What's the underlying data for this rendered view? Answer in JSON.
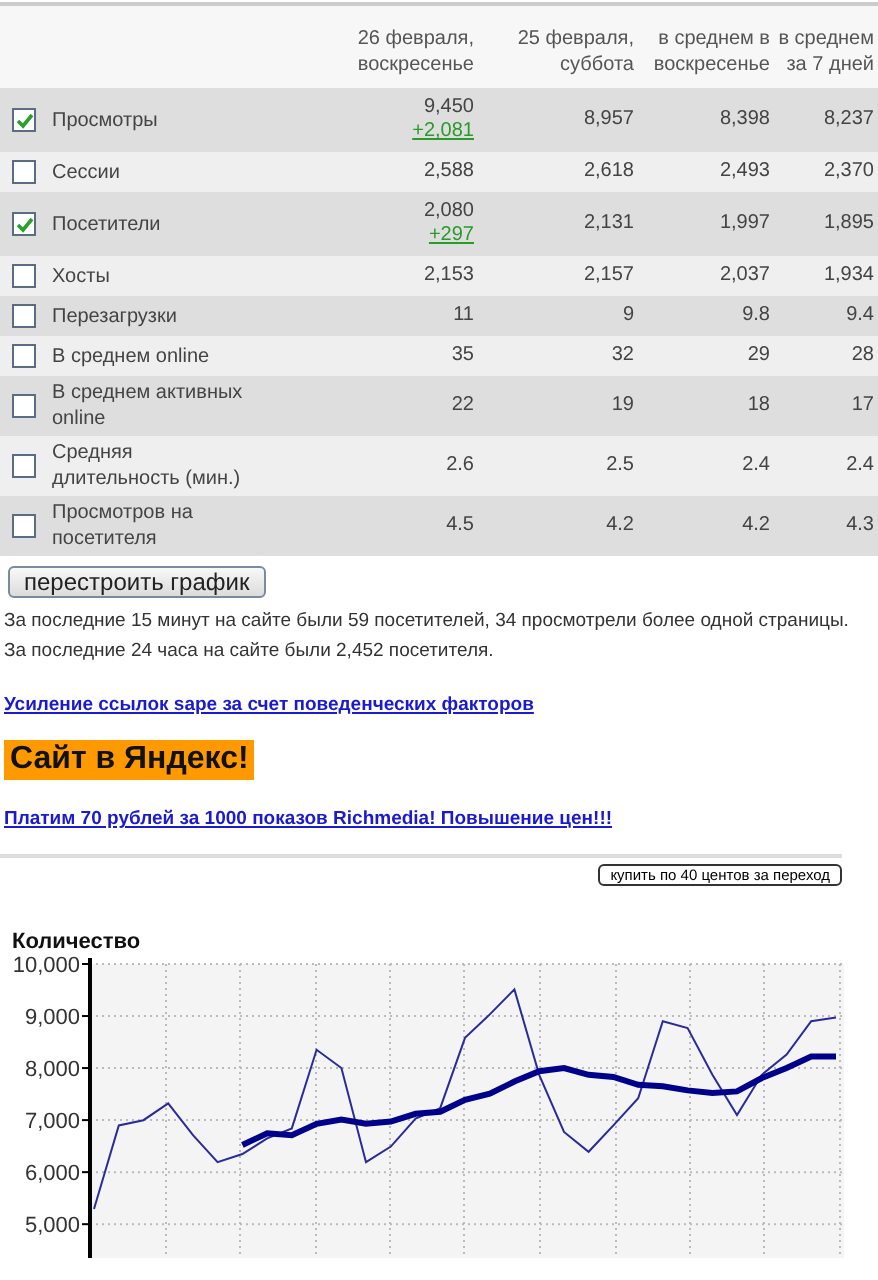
{
  "table": {
    "columns": [
      {
        "label": "26 февраля, воскресенье"
      },
      {
        "label": "25 февраля, суббота"
      },
      {
        "label": "в среднем в воскресенье"
      },
      {
        "label": "в среднем за 7 дней"
      }
    ],
    "rows": [
      {
        "label": "Просмотры",
        "checked": true,
        "values": [
          "9,450",
          "8,957",
          "8,398",
          "8,237"
        ],
        "delta": "+2,081"
      },
      {
        "label": "Сессии",
        "checked": false,
        "values": [
          "2,588",
          "2,618",
          "2,493",
          "2,370"
        ]
      },
      {
        "label": "Посетители",
        "checked": true,
        "values": [
          "2,080",
          "2,131",
          "1,997",
          "1,895"
        ],
        "delta": "+297"
      },
      {
        "label": "Хосты",
        "checked": false,
        "values": [
          "2,153",
          "2,157",
          "2,037",
          "1,934"
        ]
      },
      {
        "label": "Перезагрузки",
        "checked": false,
        "values": [
          "11",
          "9",
          "9.8",
          "9.4"
        ]
      },
      {
        "label": "В среднем online",
        "checked": false,
        "values": [
          "35",
          "32",
          "29",
          "28"
        ]
      },
      {
        "label": "В среднем активных online",
        "checked": false,
        "values": [
          "22",
          "19",
          "18",
          "17"
        ]
      },
      {
        "label": "Средняя длительность (мин.)",
        "checked": false,
        "values": [
          "2.6",
          "2.5",
          "2.4",
          "2.4"
        ]
      },
      {
        "label": "Просмотров на посетителя",
        "checked": false,
        "values": [
          "4.5",
          "4.2",
          "4.2",
          "4.3"
        ]
      }
    ]
  },
  "rebuild_button": "перестроить график",
  "summary": [
    "За последние 15 минут на сайте были 59 посетителей, 34 просмотрели более одной страницы.",
    "За последние 24 часа на сайте были 2,452 посетителя."
  ],
  "ad_link_1": "Усиление ссылок sape за счет поведенческих факторов",
  "ad_banner": "Сайт в Яндекс!",
  "ad_link_2": "Платим 70 рублей за 1000 показов Richmedia! Повышение цен!!!",
  "buy_button": "купить по 40 центов за переход",
  "chart": {
    "chart_data": {
      "type": "line",
      "ylabel": "Количество",
      "grid": true,
      "ylim": [
        4350,
        10000
      ],
      "yticks": [
        {
          "value": 5000,
          "label": "5,000"
        },
        {
          "value": 6000,
          "label": "6,000"
        },
        {
          "value": 7000,
          "label": "7,000"
        },
        {
          "value": 8000,
          "label": "8,000"
        },
        {
          "value": 9000,
          "label": "9,000"
        },
        {
          "value": 10000,
          "label": "10,000"
        }
      ],
      "series": [
        {
          "color": "#2a2a9a",
          "values": [
            5290,
            6900,
            7000,
            7320,
            6710,
            6190,
            6350,
            6650,
            6840,
            8350,
            8000,
            6190,
            6490,
            7030,
            7230,
            8580,
            9030,
            9510,
            7870,
            6770,
            6390,
            6900,
            7420,
            8900,
            8770,
            7870,
            7100,
            7870,
            8260,
            8900,
            8970
          ]
        },
        {
          "color": "#00008b",
          "values": [
            null,
            null,
            null,
            null,
            null,
            null,
            6520,
            6750,
            6710,
            6930,
            7010,
            6930,
            6970,
            7120,
            7160,
            7390,
            7510,
            7740,
            7940,
            8000,
            7870,
            7830,
            7680,
            7650,
            7570,
            7520,
            7550,
            7810,
            8000,
            8220,
            8220
          ]
        }
      ]
    }
  }
}
